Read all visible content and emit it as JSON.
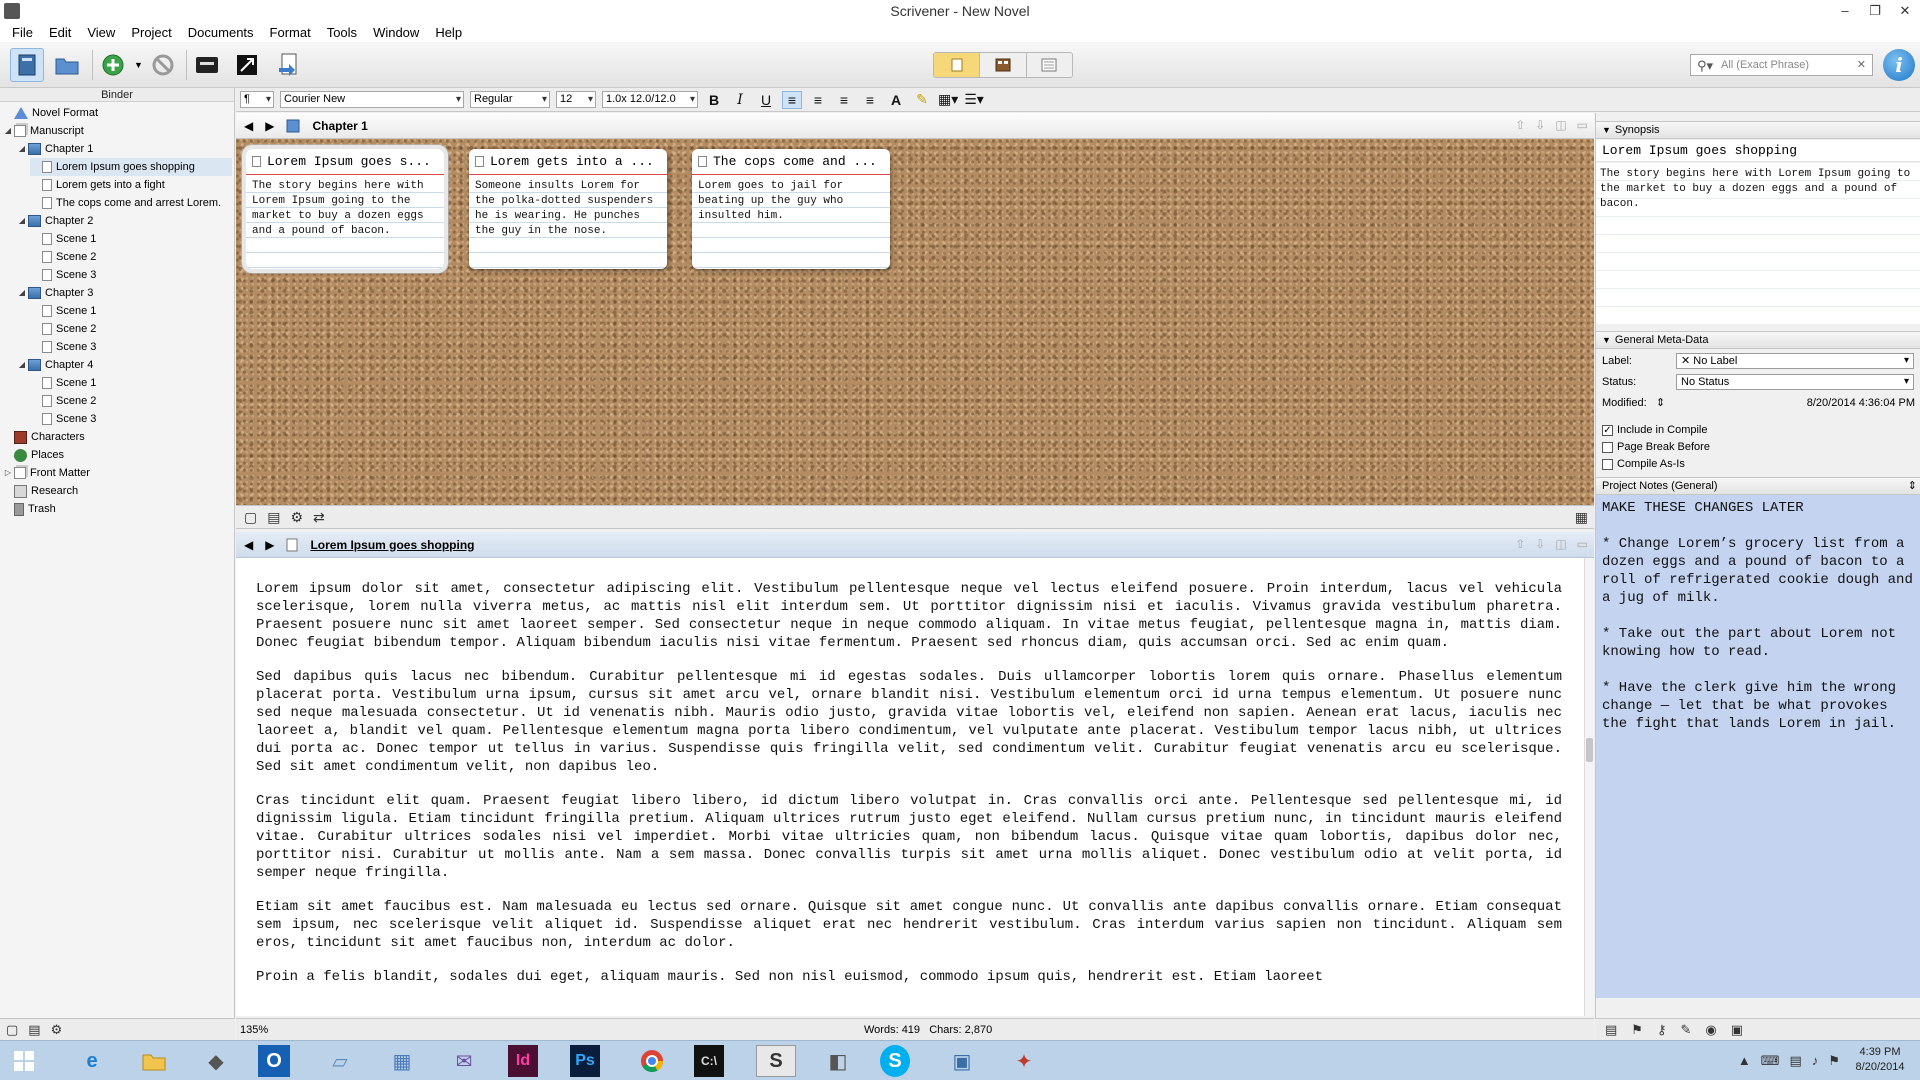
{
  "window": {
    "title": "Scrivener - New Novel",
    "controls": [
      "–",
      "❐",
      "✕"
    ]
  },
  "menu": [
    "File",
    "Edit",
    "View",
    "Project",
    "Documents",
    "Format",
    "Tools",
    "Window",
    "Help"
  ],
  "toolbar": {
    "search_placeholder": "All (Exact Phrase)"
  },
  "binder": {
    "header": "Binder",
    "items": [
      {
        "label": "Novel Format",
        "level": 0,
        "icon": "format-icon"
      },
      {
        "label": "Manuscript",
        "level": 0,
        "icon": "manuscript-icon"
      },
      {
        "label": "Chapter 1",
        "level": 1,
        "icon": "folder-icon"
      },
      {
        "label": "Lorem Ipsum goes shopping",
        "level": 2,
        "icon": "page-icon"
      },
      {
        "label": "Lorem gets into a fight",
        "level": 2,
        "icon": "page-icon"
      },
      {
        "label": "The cops come and arrest Lorem.",
        "level": 2,
        "icon": "page-icon"
      },
      {
        "label": "Chapter 2",
        "level": 1,
        "icon": "folder-icon"
      },
      {
        "label": "Scene 1",
        "level": 2,
        "icon": "page-icon"
      },
      {
        "label": "Scene 2",
        "level": 2,
        "icon": "page-icon"
      },
      {
        "label": "Scene 3",
        "level": 2,
        "icon": "page-icon"
      },
      {
        "label": "Chapter 3",
        "level": 1,
        "icon": "folder-icon"
      },
      {
        "label": "Scene 1",
        "level": 2,
        "icon": "page-icon"
      },
      {
        "label": "Scene 2",
        "level": 2,
        "icon": "page-icon"
      },
      {
        "label": "Scene 3",
        "level": 2,
        "icon": "page-icon"
      },
      {
        "label": "Chapter 4",
        "level": 1,
        "icon": "folder-icon"
      },
      {
        "label": "Scene 1",
        "level": 2,
        "icon": "page-icon"
      },
      {
        "label": "Scene 2",
        "level": 2,
        "icon": "page-icon"
      },
      {
        "label": "Scene 3",
        "level": 2,
        "icon": "page-icon"
      },
      {
        "label": "Characters",
        "level": 0,
        "icon": "characters-icon"
      },
      {
        "label": "Places",
        "level": 0,
        "icon": "places-icon"
      },
      {
        "label": "Front Matter",
        "level": 0,
        "icon": "front-matter-icon"
      },
      {
        "label": "Research",
        "level": 0,
        "icon": "research-icon"
      },
      {
        "label": "Trash",
        "level": 0,
        "icon": "trash-icon"
      }
    ]
  },
  "format": {
    "font": "Courier New",
    "style": "Regular",
    "size": "12",
    "spacing": "1.0x 12.0/12.0"
  },
  "corkboard": {
    "title": "Chapter 1",
    "cards": [
      {
        "title": "Lorem Ipsum goes s...",
        "body": "The story begins here with Lorem Ipsum going to the market to buy a dozen eggs and a pound of bacon."
      },
      {
        "title": "Lorem gets into a ...",
        "body": "Someone insults Lorem for the polka-dotted suspenders he is wearing. He punches the guy in the nose."
      },
      {
        "title": "The cops come and ...",
        "body": "Lorem goes to jail for beating up the guy who insulted him."
      }
    ]
  },
  "editor": {
    "title": "Lorem Ipsum goes shopping",
    "paragraphs": [
      "Lorem ipsum dolor sit amet, consectetur adipiscing elit. Vestibulum pellentesque neque vel lectus eleifend posuere. Proin interdum, lacus vel vehicula scelerisque, lorem nulla viverra metus, ac mattis nisl elit interdum sem. Ut porttitor dignissim nisi et iaculis. Vivamus gravida vestibulum pharetra. Praesent posuere nunc sit amet laoreet semper. Sed consectetur neque in neque commodo aliquam. In vitae metus feugiat, pellentesque magna in, mattis diam. Donec feugiat bibendum tempor. Aliquam bibendum iaculis nisi vitae fermentum. Praesent sed rhoncus diam, quis accumsan orci. Sed ac enim quam.",
      "Sed dapibus quis lacus nec bibendum. Curabitur pellentesque mi id egestas sodales. Duis ullamcorper lobortis lorem quis ornare. Phasellus elementum placerat porta. Vestibulum urna ipsum, cursus sit amet arcu vel, ornare blandit nisi. Vestibulum elementum orci id urna tempus elementum. Ut posuere nunc sed neque malesuada consectetur. Ut id venenatis nibh. Mauris odio justo, gravida vitae lobortis vel, eleifend non sapien. Aenean erat lacus, iaculis nec laoreet a, blandit vel quam. Pellentesque elementum magna porta libero condimentum, vel vulputate ante placerat. Vestibulum tempor lacus nibh, ut ultrices dui porta ac. Donec tempor ut tellus in varius. Suspendisse quis fringilla velit, sed condimentum velit. Curabitur feugiat venenatis arcu eu scelerisque. Sed sit amet condimentum velit, non dapibus leo.",
      "Cras tincidunt elit quam. Praesent feugiat libero libero, id dictum libero volutpat in. Cras convallis orci ante. Pellentesque sed pellentesque mi, id dignissim ligula. Etiam tincidunt fringilla pretium. Aliquam ultrices rutrum justo eget eleifend. Nullam cursus pretium nunc, in tincidunt mauris eleifend vitae. Curabitur ultrices sodales nisi vel imperdiet. Morbi vitae ultricies quam, non bibendum lacus. Quisque vitae quam lobortis, dapibus dolor nec, porttitor nisi. Curabitur ut mollis ante. Nam a sem massa. Donec convallis turpis sit amet urna mollis aliquet. Donec vestibulum odio at velit porta, id semper neque fringilla.",
      "Etiam sit amet faucibus est. Nam malesuada eu lectus sed ornare. Quisque sit amet congue nunc. Ut convallis ante dapibus convallis ornare. Etiam consequat sem ipsum, nec scelerisque velit aliquet id. Suspendisse aliquet erat nec hendrerit vestibulum. Cras interdum varius sapien non tincidunt. Aliquam sem eros, tincidunt sit amet faucibus non, interdum ac dolor.",
      "Proin a felis blandit, sodales dui eget, aliquam mauris. Sed non nisl euismod, commodo ipsum quis, hendrerit est. Etiam laoreet"
    ]
  },
  "status": {
    "zoom": "135%",
    "counts": "Words: 419   Chars: 2,870"
  },
  "inspector": {
    "synopsis_header": "Synopsis",
    "synopsis_title": "Lorem Ipsum goes shopping",
    "synopsis_body": "The story begins here with Lorem Ipsum going to the market to buy a dozen eggs and a pound of bacon.",
    "meta_header": "General Meta-Data",
    "label_label": "Label:",
    "label_value": "No Label",
    "status_label": "Status:",
    "status_value": "No Status",
    "modified_label": "Modified:",
    "modified_value": "8/20/2014 4:36:04 PM",
    "include_compile": "Include in Compile",
    "page_break": "Page Break Before",
    "compile_as_is": "Compile As-Is",
    "notes_header": "Project Notes (General)",
    "notes": [
      "MAKE THESE CHANGES LATER",
      "* Change Lorem’s grocery list from a dozen eggs and a pound of bacon to a roll of refrigerated cookie dough and a jug of milk.",
      "* Take out the part about Lorem not knowing how to read.",
      "* Have the clerk give him the wrong change — let that be what provokes the fight that lands Lorem in jail."
    ]
  },
  "taskbar": {
    "apps": [
      "start",
      "internet-explorer",
      "file-explorer",
      "app",
      "outlook",
      "app",
      "calculator",
      "onenote",
      "indesign",
      "photoshop",
      "chrome",
      "terminal",
      "scrivener",
      "app",
      "skype",
      "app",
      "app"
    ],
    "time": "4:39 PM",
    "date": "8/20/2014"
  }
}
